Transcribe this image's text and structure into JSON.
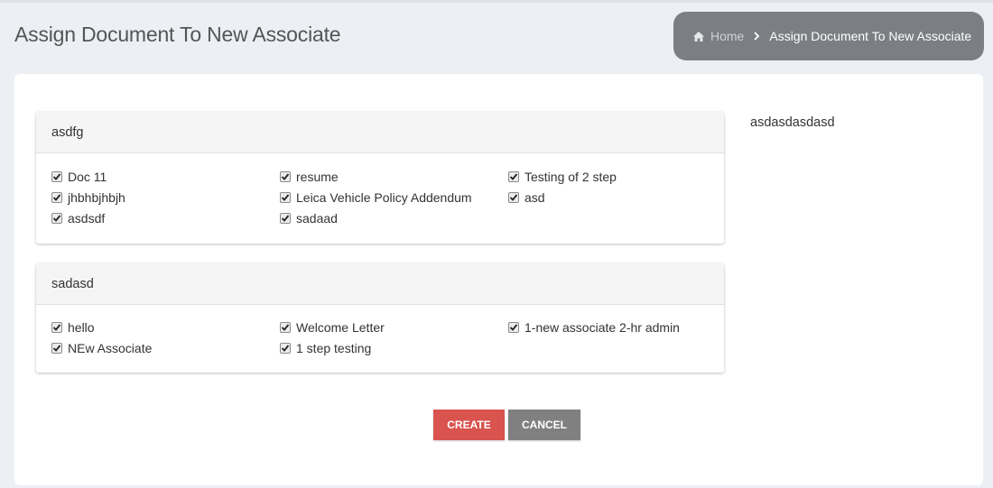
{
  "header": {
    "title": "Assign Document To New Associate"
  },
  "breadcrumb": {
    "home_label": "Home",
    "current_label": "Assign Document To New Associate",
    "home_icon": "home-icon",
    "separator_icon": "chevron-right-icon"
  },
  "groups": [
    {
      "title": "asdfg",
      "documents": [
        {
          "label": "Doc 11",
          "checked": true
        },
        {
          "label": "resume",
          "checked": true
        },
        {
          "label": "Testing of 2 step",
          "checked": true
        },
        {
          "label": "jhbhbjhbjh",
          "checked": true
        },
        {
          "label": "Leica Vehicle Policy Addendum",
          "checked": true
        },
        {
          "label": "asd",
          "checked": true
        },
        {
          "label": "asdsdf",
          "checked": true
        },
        {
          "label": "sadaad",
          "checked": true
        }
      ]
    },
    {
      "title": "sadasd",
      "documents": [
        {
          "label": "hello",
          "checked": true
        },
        {
          "label": "Welcome Letter",
          "checked": true
        },
        {
          "label": "1-new associate 2-hr admin",
          "checked": true
        },
        {
          "label": "NEw Associate",
          "checked": true
        },
        {
          "label": "1 step testing",
          "checked": true
        }
      ]
    }
  ],
  "side_text": "asdasdasdasd",
  "actions": {
    "create_label": "CREATE",
    "cancel_label": "CANCEL"
  },
  "colors": {
    "create": "#d9534f",
    "cancel": "#808080",
    "breadcrumb_bg": "#7b7e82",
    "page_bg": "#eceff3"
  }
}
